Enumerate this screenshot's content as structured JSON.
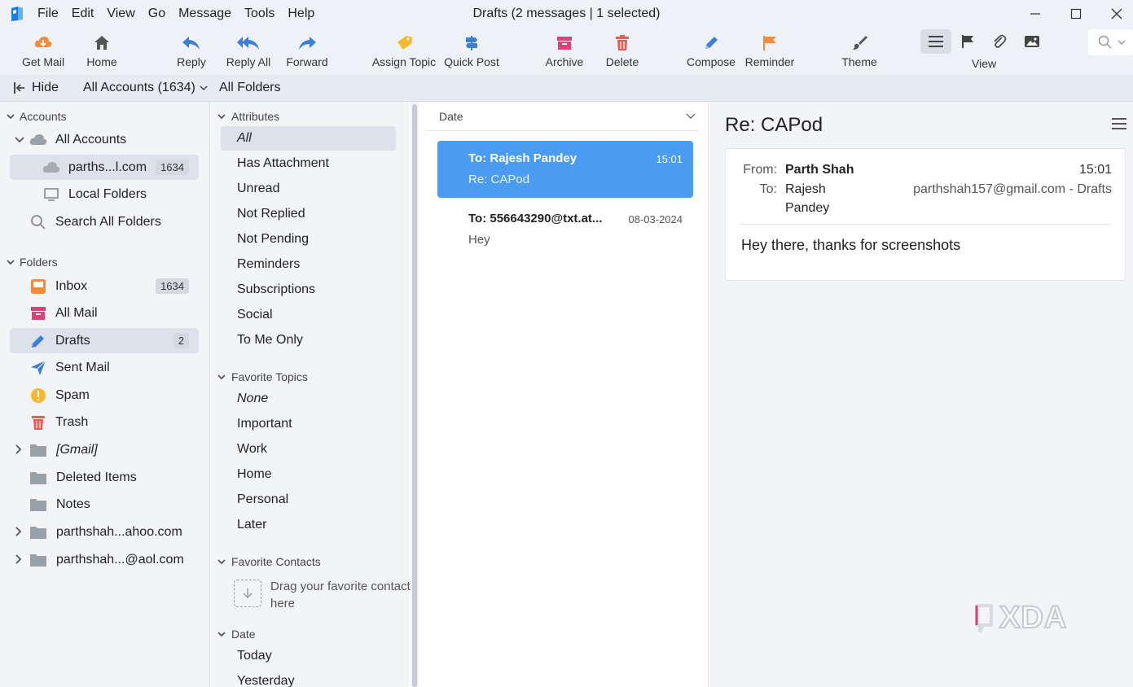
{
  "window": {
    "title": "Drafts (2 messages | 1 selected)",
    "menu": [
      "File",
      "Edit",
      "View",
      "Go",
      "Message",
      "Tools",
      "Help"
    ]
  },
  "toolbar": {
    "get_mail": "Get Mail",
    "home": "Home",
    "reply": "Reply",
    "reply_all": "Reply All",
    "forward": "Forward",
    "assign_topic": "Assign Topic",
    "quick_post": "Quick Post",
    "archive": "Archive",
    "delete": "Delete",
    "compose": "Compose",
    "reminder": "Reminder",
    "theme": "Theme",
    "view": "View"
  },
  "locbar": {
    "hide": "Hide",
    "accounts": "All Accounts (1634)",
    "folders": "All Folders"
  },
  "sidebar": {
    "accounts_header": "Accounts",
    "all_accounts": "All Accounts",
    "account_1": {
      "label": "parths...l.com",
      "count": "1634"
    },
    "local_folders": "Local Folders",
    "search_all": "Search All Folders",
    "folders_header": "Folders",
    "folders": [
      {
        "label": "Inbox",
        "count": "1634"
      },
      {
        "label": "All Mail"
      },
      {
        "label": "Drafts",
        "count": "2"
      },
      {
        "label": "Sent Mail"
      },
      {
        "label": "Spam"
      },
      {
        "label": "Trash"
      },
      {
        "label": "[Gmail]"
      },
      {
        "label": "Deleted Items"
      },
      {
        "label": "Notes"
      },
      {
        "label": "parthshah...ahoo.com"
      },
      {
        "label": "parthshah...@aol.com"
      }
    ]
  },
  "filters": {
    "attributes_header": "Attributes",
    "attributes": [
      "All",
      "Has Attachment",
      "Unread",
      "Not Replied",
      "Not Pending",
      "Reminders",
      "Subscriptions",
      "Social",
      "To Me Only"
    ],
    "topics_header": "Favorite Topics",
    "topics": [
      "None",
      "Important",
      "Work",
      "Home",
      "Personal",
      "Later"
    ],
    "contacts_header": "Favorite Contacts",
    "contacts_hint": "Drag your favorite contacts here",
    "date_header": "Date",
    "dates": [
      "Today",
      "Yesterday"
    ]
  },
  "message_list": {
    "sort_label": "Date",
    "messages": [
      {
        "to": "To: Rajesh Pandey",
        "time": "15:01",
        "subject": "Re: CAPod"
      },
      {
        "to": "To: 556643290@txt.at...",
        "time": "08-03-2024",
        "subject": "Hey"
      }
    ]
  },
  "reader": {
    "subject": "Re: CAPod",
    "from_label": "From:",
    "from": "Parth Shah",
    "time": "15:01",
    "to_label": "To:",
    "to_line1": "Rajesh",
    "to_line2": "Pandey",
    "account": "parthshah157@gmail.com - Drafts",
    "body": "Hey there, thanks for screenshots"
  },
  "watermark": "XDA",
  "colors": {
    "selection": "#4a9cf0",
    "reply_blue": "#3d7fd6",
    "archive_pink": "#e0407a",
    "delete_red": "#e85d4f",
    "topic_yellow": "#f5b82e",
    "reminder_orange": "#f28b3c"
  }
}
